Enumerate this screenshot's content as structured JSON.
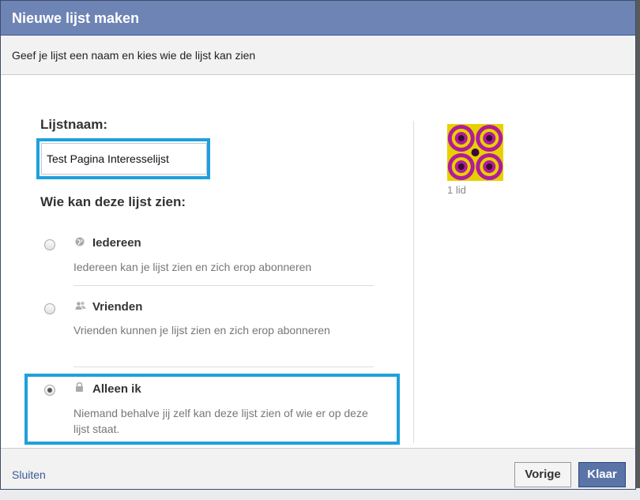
{
  "dialog": {
    "title": "Nieuwe lijst maken",
    "subtitle": "Geef je lijst een naam en kies wie de lijst kan zien"
  },
  "form": {
    "name_label": "Lijstnaam:",
    "name_value": "Test Pagina Interesselijst",
    "visibility_label": "Wie kan deze lijst zien:"
  },
  "options": [
    {
      "title": "Iedereen",
      "desc": "Iedereen kan je lijst zien en zich erop abonneren",
      "icon": "globe-icon",
      "checked": false
    },
    {
      "title": "Vrienden",
      "desc": "Vrienden kunnen je lijst zien en zich erop abonneren",
      "icon": "friends-icon",
      "checked": false
    },
    {
      "title": "Alleen ik",
      "desc": "Niemand behalve jij zelf kan deze lijst zien of wie er op deze lijst staat.",
      "icon": "lock-icon",
      "checked": true
    }
  ],
  "preview": {
    "members": "1 lid"
  },
  "footer": {
    "close": "Sluiten",
    "prev": "Vorige",
    "done": "Klaar"
  },
  "colors": {
    "titlebar": "#6d84b4",
    "highlight": "#1ea0dc",
    "done_button": "#5b74a8"
  }
}
